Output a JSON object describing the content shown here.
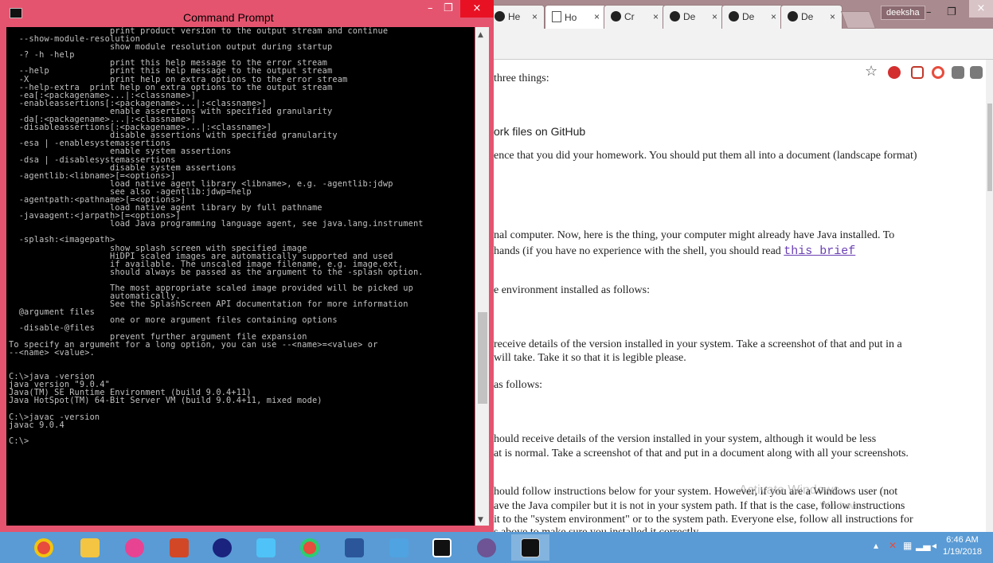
{
  "browser": {
    "tabs": [
      {
        "label": "He",
        "icon": "github-icon"
      },
      {
        "label": "Ho",
        "icon": "document-icon"
      },
      {
        "label": "Cr",
        "icon": "github-icon"
      },
      {
        "label": "De",
        "icon": "github-icon"
      },
      {
        "label": "De",
        "icon": "github-icon"
      },
      {
        "label": "De",
        "icon": "github-icon"
      }
    ],
    "tab_close": "×",
    "profile": "deeksha",
    "window_min": "–",
    "window_max": "❐",
    "window_close": "×",
    "content_lines": [
      "three things:",
      "ork files on GitHub",
      "ence that you did your homework. You should put them all into a document (landscape format)",
      "nal computer. Now, here is the thing, your computer might already have Java installed. To",
      "hands (if you have no experience with the shell, you should read ",
      "this brief",
      "e environment installed as follows:",
      " receive details of the version installed in your system. Take a screenshot of that and put in a",
      " will take. Take it so that it is legible please.",
      "as follows:",
      "hould receive details of the version installed in your system, although it would be less",
      "at is normal. Take a screenshot of that and put in a document along with all your screenshots.",
      "hould follow instructions below for your system. However, if you are a Windows user (not",
      "ave the Java compiler but it is not in your system path. If that is the case, follow instructions",
      " it to the \"system environment\" or to the system path. Everyone else, follow all instructions for",
      "s above to make sure you installed it correctly."
    ],
    "watermark_title": "Activate Windows",
    "watermark_sub": "Windows."
  },
  "cmd": {
    "title": "Command Prompt",
    "min": "–",
    "max": "❐",
    "close": "×",
    "output": "                    print product version to the output stream and continue\n  --show-module-resolution\n                    show module resolution output during startup\n  -? -h -help\n                    print this help message to the error stream\n  --help            print this help message to the output stream\n  -X                print help on extra options to the error stream\n  --help-extra  print help on extra options to the output stream\n  -ea[:<packagename>...|:<classname>]\n  -enableassertions[:<packagename>...|:<classname>]\n                    enable assertions with specified granularity\n  -da[:<packagename>...|:<classname>]\n  -disableassertions[:<packagename>...|:<classname>]\n                    disable assertions with specified granularity\n  -esa | -enablesystemassertions\n                    enable system assertions\n  -dsa | -disablesystemassertions\n                    disable system assertions\n  -agentlib:<libname>[=<options>]\n                    load native agent library <libname>, e.g. -agentlib:jdwp\n                    see also -agentlib:jdwp=help\n  -agentpath:<pathname>[=<options>]\n                    load native agent library by full pathname\n  -javaagent:<jarpath>[=<options>]\n                    load Java programming language agent, see java.lang.instrument\n\n  -splash:<imagepath>\n                    show splash screen with specified image\n                    HiDPI scaled images are automatically supported and used\n                    if available. The unscaled image filename, e.g. image.ext,\n                    should always be passed as the argument to the -splash option.\n\n                    The most appropriate scaled image provided will be picked up\n                    automatically.\n                    See the SplashScreen API documentation for more information\n  @argument files\n                    one or more argument files containing options\n  -disable-@files\n                    prevent further argument file expansion\nTo specify an argument for a long option, you can use --<name>=<value> or\n--<name> <value>.\n\n\nC:\\>java -version\njava version \"9.0.4\"\nJava(TM) SE Runtime Environment (build 9.0.4+11)\nJava HotSpot(TM) 64-Bit Server VM (build 9.0.4+11, mixed mode)\n\nC:\\>javac -version\njavac 9.0.4\n\nC:\\>"
  },
  "taskbar": {
    "apps": [
      "chrome-icon",
      "file-explorer-icon",
      "itunes-icon",
      "powerpoint-icon",
      "app-icon",
      "notepad-icon",
      "chrome-icon",
      "word-icon",
      "control-panel-icon",
      "intellij-icon",
      "github-desktop-icon",
      "cmd-icon"
    ],
    "time": "6:46 AM",
    "date": "1/19/2018"
  },
  "colors": {
    "cmd_frame": "#e5546f",
    "tabstrip": "#a98a8e",
    "taskbar": "#5a9bd5",
    "link": "#6a3fb3"
  }
}
